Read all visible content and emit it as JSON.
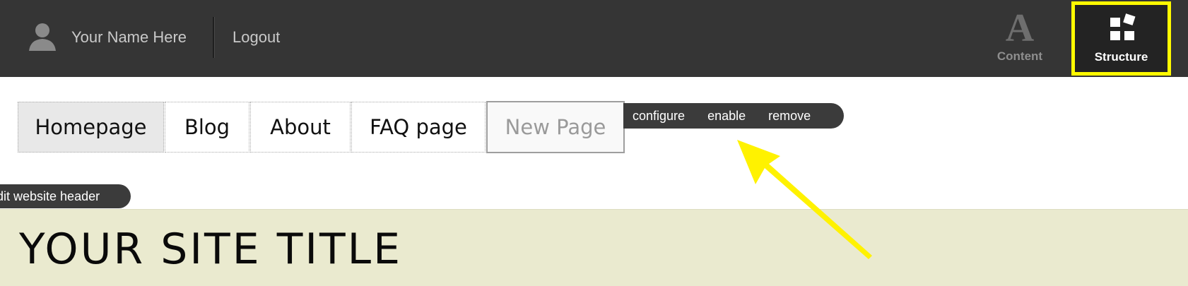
{
  "toolbar": {
    "user_name": "Your Name Here",
    "logout_label": "Logout",
    "content_glyph": "A",
    "content_label": "Content",
    "structure_label": "Structure"
  },
  "menu": {
    "tabs": [
      {
        "label": "Homepage",
        "active": true
      },
      {
        "label": "Blog",
        "active": false
      },
      {
        "label": "About",
        "active": false
      },
      {
        "label": "FAQ page",
        "active": false
      },
      {
        "label": "New Page",
        "active": false
      }
    ]
  },
  "context_links": {
    "configure": "configure",
    "enable": "enable",
    "remove": "remove"
  },
  "edit_header_label": "dit website header",
  "site": {
    "title": "YOUR SITE TITLE"
  },
  "colors": {
    "toolbar_bg": "#353535",
    "highlight": "#fffa00",
    "header_bg": "#eaeacf"
  }
}
